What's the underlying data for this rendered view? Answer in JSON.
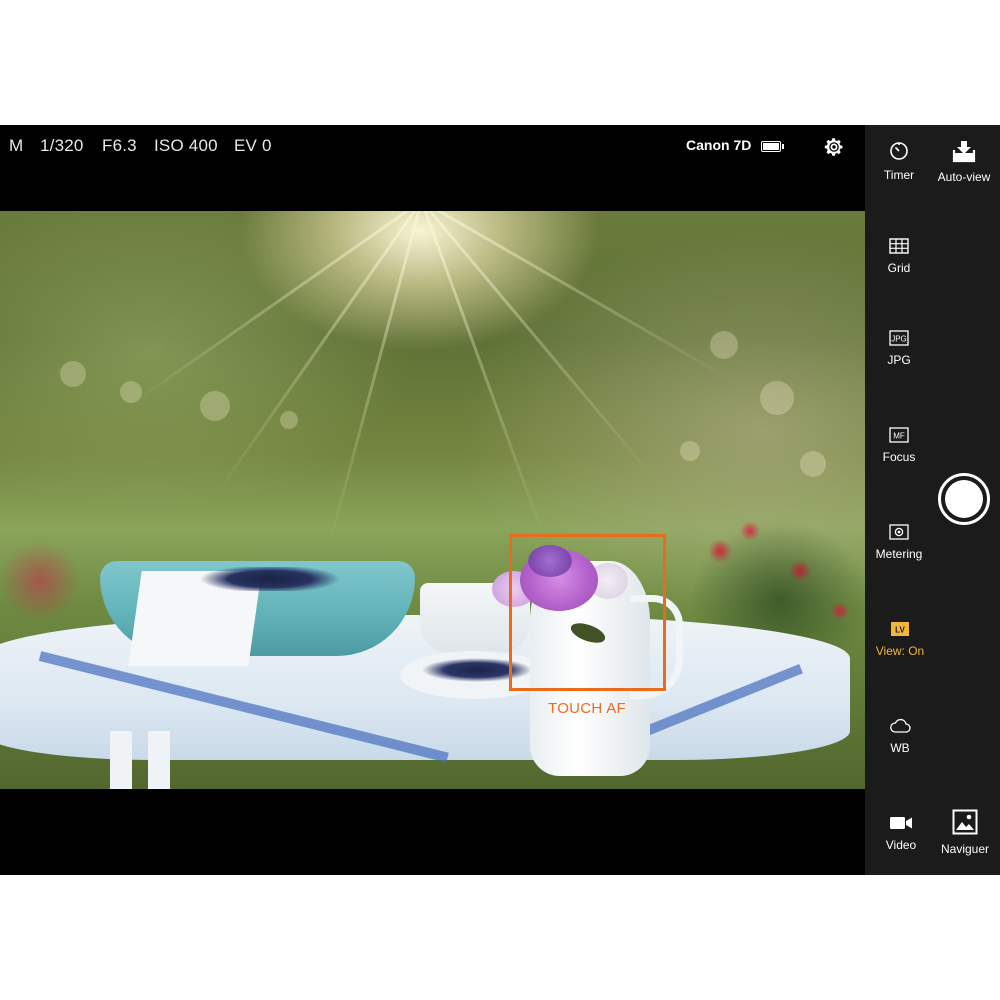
{
  "status": {
    "mode": "M",
    "shutter": "1/320",
    "aperture": "F6.3",
    "iso": "ISO 400",
    "ev": "EV 0",
    "camera": "Canon 7D",
    "battery_icon": "battery-full-icon",
    "settings_icon": "gear-icon"
  },
  "liveview": {
    "af_label": "TOUCH AF",
    "af_color": "#e96b1c"
  },
  "panel": {
    "timer": "Timer",
    "autoview": "Auto-view",
    "grid": "Grid",
    "jpg": "JPG",
    "jpg_badge": "JPG",
    "focus": "Focus",
    "focus_badge": "MF",
    "metering": "Metering",
    "lv_badge": "LV",
    "view": "View: On",
    "wb": "WB",
    "video": "Video",
    "browse": "Naviguer",
    "active_color": "#f4b63a"
  }
}
